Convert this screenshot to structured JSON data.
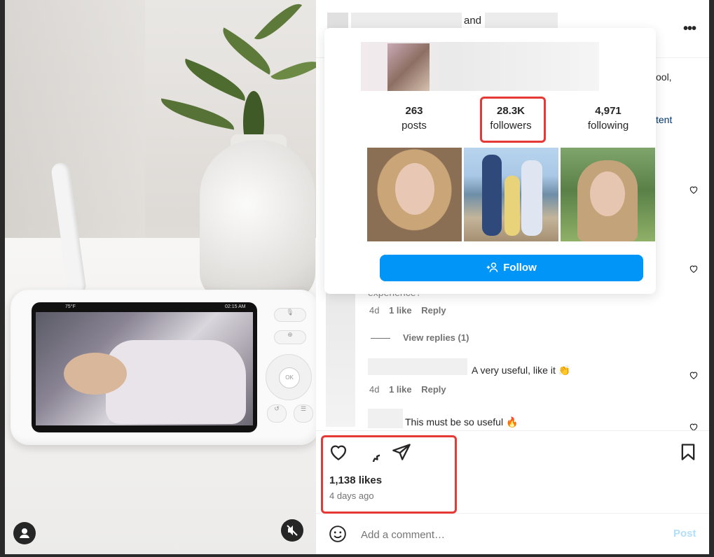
{
  "header": {
    "connector": "and"
  },
  "caption": {
    "snippet1": "ool,",
    "snippet2": "tent"
  },
  "hover_card": {
    "stats": [
      {
        "value": "263",
        "label": "posts"
      },
      {
        "value": "28.3K",
        "label": "followers"
      },
      {
        "value": "4,971",
        "label": "following"
      }
    ],
    "follow_label": "Follow"
  },
  "comments": [
    {
      "text": "experience?",
      "age": "4d",
      "likes": "1 like",
      "reply": "Reply"
    },
    {
      "view_replies": "View replies (1)"
    },
    {
      "text": "A very useful, like it 👏",
      "age": "4d",
      "likes": "1 like",
      "reply": "Reply"
    },
    {
      "text": "This must be so useful 🔥"
    }
  ],
  "post": {
    "likes": "1,138 likes",
    "age": "4 days ago"
  },
  "comment_box": {
    "placeholder": "Add a comment…",
    "post_label": "Post"
  },
  "monitor_screen": {
    "temp": "75°F",
    "time": "02:15 AM",
    "ok": "OK"
  },
  "colors": {
    "accent": "#0095f6",
    "highlight": "#e53935"
  },
  "icons": [
    "more-icon",
    "heart-icon",
    "comment-icon",
    "share-icon",
    "bookmark-icon",
    "emoji-icon",
    "add-person-icon",
    "mute-icon",
    "user-icon"
  ]
}
